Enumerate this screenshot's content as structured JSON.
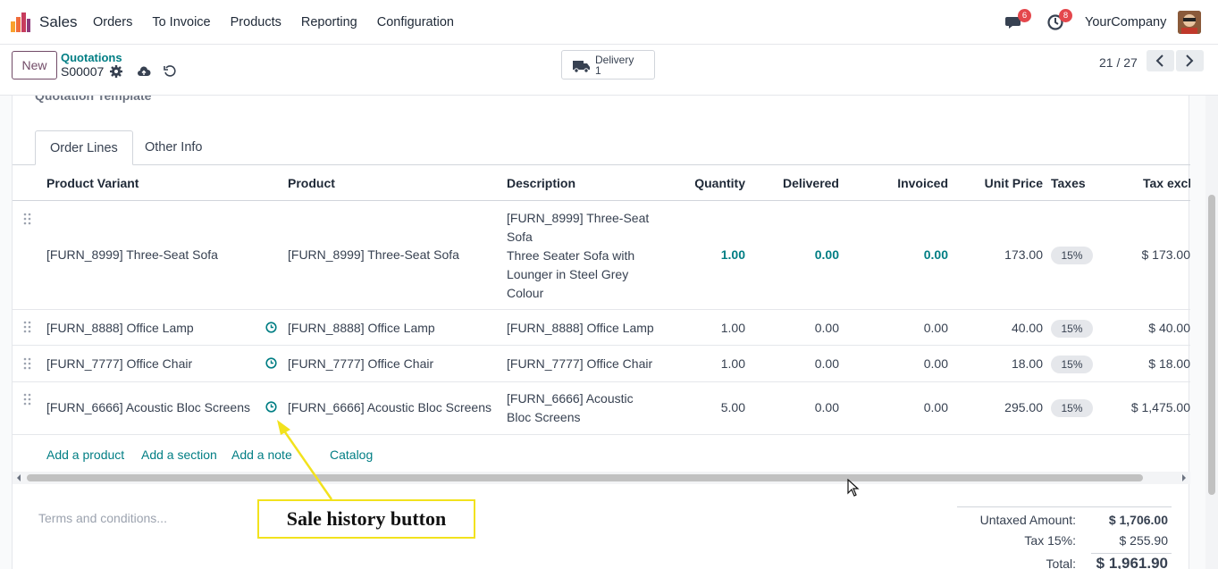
{
  "nav": {
    "app_name": "Sales",
    "menu": [
      "Orders",
      "To Invoice",
      "Products",
      "Reporting",
      "Configuration"
    ],
    "chat_badge": "6",
    "activity_badge": "8",
    "company": "YourCompany"
  },
  "control": {
    "new_label": "New",
    "breadcrumb_parent": "Quotations",
    "record_name": "S00007",
    "smart_button": {
      "label": "Delivery",
      "count": "1"
    },
    "pager": "21 / 27"
  },
  "form": {
    "partial_label": "Quotation Template",
    "tabs": [
      "Order Lines",
      "Other Info"
    ],
    "columns": [
      "Product Variant",
      "Product",
      "Description",
      "Quantity",
      "Delivered",
      "Invoiced",
      "Unit Price",
      "Taxes",
      "Tax excl."
    ],
    "lines": [
      {
        "variant": "[FURN_8999] Three-Seat Sofa",
        "product": "[FURN_8999] Three-Seat Sofa",
        "description": [
          "[FURN_8999] Three-Seat",
          "Sofa",
          "Three Seater Sofa with",
          "Lounger in Steel Grey",
          "Colour"
        ],
        "quantity": "1.00",
        "delivered": "0.00",
        "invoiced": "0.00",
        "unit_price": "173.00",
        "tax": "15%",
        "subtotal": "$ 173.00"
      },
      {
        "variant": "[FURN_8888] Office Lamp",
        "product": "[FURN_8888] Office Lamp",
        "description": [
          "[FURN_8888] Office Lamp"
        ],
        "quantity": "1.00",
        "delivered": "0.00",
        "invoiced": "0.00",
        "unit_price": "40.00",
        "tax": "15%",
        "subtotal": "$ 40.00"
      },
      {
        "variant": "[FURN_7777] Office Chair",
        "product": "[FURN_7777] Office Chair",
        "description": [
          "[FURN_7777] Office Chair"
        ],
        "quantity": "1.00",
        "delivered": "0.00",
        "invoiced": "0.00",
        "unit_price": "18.00",
        "tax": "15%",
        "subtotal": "$ 18.00"
      },
      {
        "variant": "[FURN_6666] Acoustic Bloc Screens",
        "product": "[FURN_6666] Acoustic Bloc Screens",
        "description": [
          "[FURN_6666] Acoustic",
          "Bloc Screens"
        ],
        "quantity": "5.00",
        "delivered": "0.00",
        "invoiced": "0.00",
        "unit_price": "295.00",
        "tax": "15%",
        "subtotal": "$ 1,475.00"
      }
    ],
    "add_links": [
      "Add a product",
      "Add a section",
      "Add a note",
      "Catalog"
    ],
    "terms_placeholder": "Terms and conditions...",
    "totals": [
      {
        "label": "Untaxed Amount:",
        "value": "$ 1,706.00"
      },
      {
        "label": "Tax 15%:",
        "value": "$ 255.90"
      },
      {
        "label": "Total:",
        "value": "$ 1,961.90"
      }
    ]
  },
  "annotation": {
    "text": "Sale history button",
    "color": "#f2e21d"
  },
  "colors": {
    "accent": "#714b67",
    "link": "#017e84",
    "badge": "#e4474c"
  }
}
